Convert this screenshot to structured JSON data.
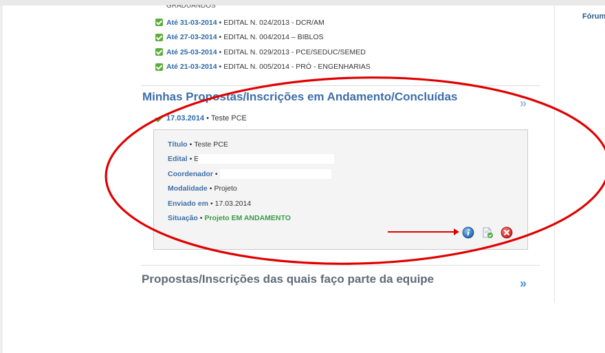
{
  "side": {
    "forum_link": "Fórum"
  },
  "top_cut_text": "GRADUANDOS",
  "editais": [
    {
      "date": "Até 31-03-2014",
      "name": "EDITAL N. 024/2013 - DCR/AM"
    },
    {
      "date": "Até 27-03-2014",
      "name": "EDITAL N. 004/2014 – BIBLOS"
    },
    {
      "date": "Até 25-03-2014",
      "name": "EDITAL N. 029/2013 - PCE/SEDUC/SEMED"
    },
    {
      "date": "Até 21-03-2014",
      "name": "EDITAL N. 005/2014 - PRÓ - ENGENHARIAS"
    }
  ],
  "separator": "•",
  "section1": {
    "title": "Minhas Propostas/Inscrições em Andamento/Concluídas"
  },
  "proposal": {
    "date": "17.03.2014",
    "name": "Teste PCE",
    "details": {
      "titulo_label": "Título",
      "titulo_value": "Teste PCE",
      "edital_label": "Edital",
      "edital_value": "E",
      "coordenador_label": "Coordenador",
      "coordenador_value": "",
      "modalidade_label": "Modalidade",
      "modalidade_value": "Projeto",
      "enviado_label": "Enviado em",
      "enviado_value": "17.03.2014",
      "situacao_label": "Situação",
      "situacao_value": "Projeto EM ANDAMENTO"
    }
  },
  "section2": {
    "title": "Propostas/Inscrições das quais faço parte da equipe"
  },
  "icons": {
    "check_icon": "check-square-icon",
    "info_icon": "info-icon",
    "edit_doc_icon": "document-check-icon",
    "delete_icon": "delete-icon",
    "chevron": "double-chevron-right-icon"
  },
  "colors": {
    "link_blue": "#2a69a8",
    "title_blue": "#3c6eab",
    "status_green": "#3a9a45",
    "annotation_red": "#e00000"
  }
}
